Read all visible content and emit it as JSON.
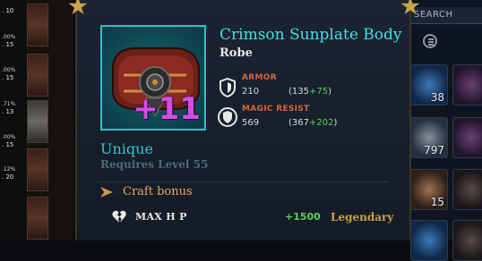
{
  "background_left": {
    "rows": [
      {
        "pct": "",
        "val": ". 10"
      },
      {
        "pct": ".00%",
        "val": ". 15"
      },
      {
        "pct": ".00%",
        "val": ". 15"
      },
      {
        "pct": ".71%",
        "val": ". 13"
      },
      {
        "pct": ".00%",
        "val": ". 15"
      },
      {
        "pct": ".12%",
        "val": ". 20"
      }
    ]
  },
  "background_right": {
    "search_label": "SEARCH",
    "slots": [
      {
        "count": "38",
        "tint": "blue"
      },
      {
        "count": "",
        "tint": "purple"
      },
      {
        "count": "797",
        "tint": "gray"
      },
      {
        "count": "",
        "tint": "purple"
      },
      {
        "count": "15",
        "tint": "brown"
      },
      {
        "count": "",
        "tint": "dark"
      },
      {
        "count": "",
        "tint": "blue"
      },
      {
        "count": "",
        "tint": "dark"
      }
    ]
  },
  "tooltip": {
    "item_name": "Crimson Sunplate Body",
    "item_type": "Robe",
    "enhancement": "+11",
    "rarity": "Unique",
    "requirement": "Requires Level 55",
    "stats": [
      {
        "label": "ARMOR",
        "value": "210",
        "base": "(135",
        "bonus": "+75",
        "close": ")",
        "icon": "shield-icon"
      },
      {
        "label": "MAGIC RESIST",
        "value": "569",
        "base": "(367",
        "bonus": "+202",
        "close": ")",
        "icon": "magic-shield-icon"
      }
    ],
    "craft_bonus": {
      "title": "Craft bonus",
      "stat": "MAX H P",
      "value": "+1500",
      "tier": "Legendary",
      "icon": "broken-heart-icon"
    }
  },
  "colors": {
    "item_name": "#44e1e2",
    "rarity": "#33c6c8",
    "enhancement": "#d44ce8",
    "stat_label": "#d9643e",
    "bonus_green": "#57d157",
    "legendary": "#c9a24a",
    "craft_title": "#e8a662"
  }
}
